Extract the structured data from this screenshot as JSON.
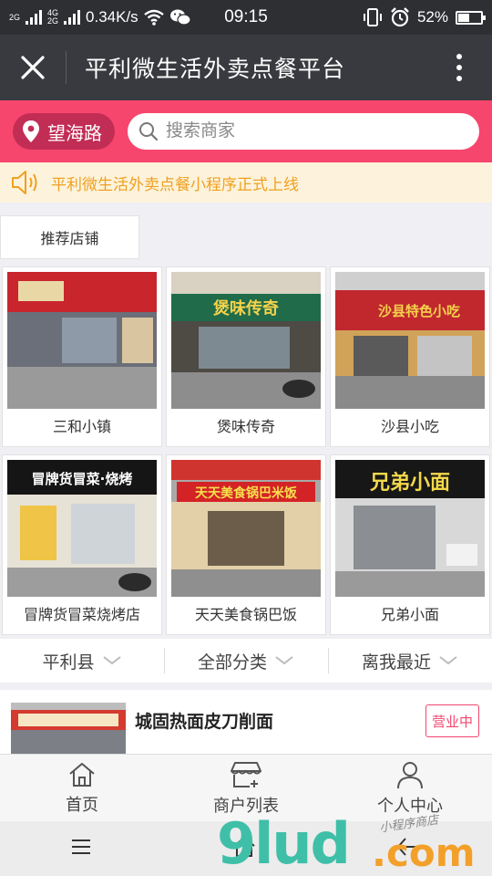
{
  "status_bar": {
    "net_top": "2G",
    "net_mid": "4G",
    "net_bot": "2G",
    "speed": "0.34K/s",
    "time": "09:15",
    "battery": "52%",
    "battery_level": 0.52
  },
  "title_bar": {
    "title": "平利微生活外卖点餐平台"
  },
  "search": {
    "location": "望海路",
    "placeholder": "搜索商家"
  },
  "notice": {
    "text": "平利微生活外卖点餐小程序正式上线"
  },
  "section": {
    "tab_label": "推荐店铺"
  },
  "shops": [
    {
      "name": "三和小镇",
      "sign": "",
      "sign_color": "#c8252d"
    },
    {
      "name": "煲味传奇",
      "sign": "煲味传奇",
      "sign_color": "#1f6b4a"
    },
    {
      "name": "沙县小吃",
      "sign": "沙县特色小吃",
      "sign_color": "#c0282e"
    },
    {
      "name": "冒牌货冒菜烧烤店",
      "sign": "冒牌货冒菜·烧烤",
      "sign_color": "#151515"
    },
    {
      "name": "天天美食锅巴饭",
      "sign": "天天美食锅巴米饭",
      "sign_color": "#d42326"
    },
    {
      "name": "兄弟小面",
      "sign": "兄弟小面",
      "sign_color": "#171717"
    }
  ],
  "filters": [
    {
      "label": "平利县"
    },
    {
      "label": "全部分类"
    },
    {
      "label": "离我最近"
    }
  ],
  "list": [
    {
      "title": "城固热面皮刀削面",
      "status": "营业中"
    }
  ],
  "tabbar": [
    {
      "label": "首页",
      "icon": "home-icon"
    },
    {
      "label": "商户列表",
      "icon": "store-icon"
    },
    {
      "label": "个人中心",
      "icon": "user-icon"
    }
  ],
  "watermark": {
    "brand": "9lud",
    "domain": ".com",
    "slogan": "小程序商店"
  },
  "colors": {
    "brand_pink": "#f7466e",
    "location_pill": "#c22d55",
    "notice_text": "#f0a020",
    "titlebar": "#393a3f"
  }
}
